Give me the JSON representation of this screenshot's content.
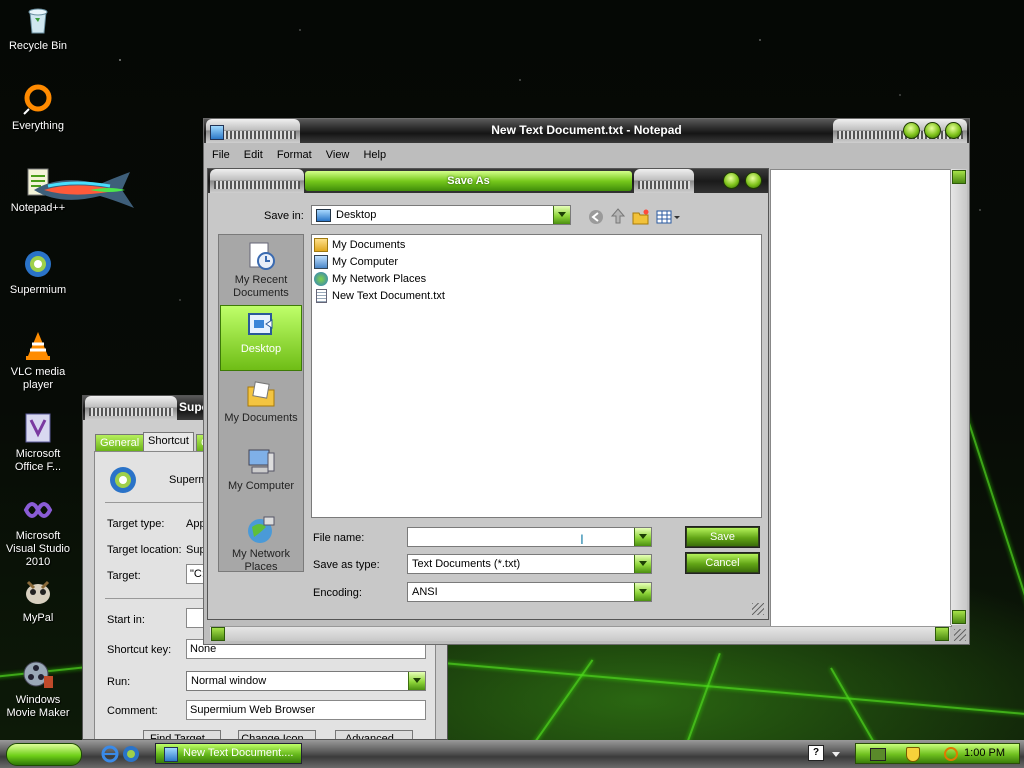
{
  "desktop": {
    "icons": [
      {
        "label": "Recycle Bin"
      },
      {
        "label": "Everything"
      },
      {
        "label": "Notepad++"
      },
      {
        "label": "Supermium"
      },
      {
        "label": "VLC media player"
      },
      {
        "label": "Microsoft Office F..."
      },
      {
        "label": "Microsoft Visual Studio 2010"
      },
      {
        "label": "MyPal"
      },
      {
        "label": "Windows Movie Maker"
      }
    ]
  },
  "notepad": {
    "title": "New Text Document.txt - Notepad",
    "menu": [
      "File",
      "Edit",
      "Format",
      "View",
      "Help"
    ]
  },
  "save_dialog": {
    "title": "Save As",
    "save_in_label": "Save in:",
    "save_in_value": "Desktop",
    "places": [
      "My Recent Documents",
      "Desktop",
      "My Documents",
      "My Computer",
      "My Network Places"
    ],
    "selected_place": "Desktop",
    "files": [
      "My Documents",
      "My Computer",
      "My Network Places",
      "New Text Document.txt"
    ],
    "file_name_label": "File name:",
    "file_name_value": "",
    "save_as_type_label": "Save as type:",
    "save_as_type_value": "Text Documents (*.txt)",
    "encoding_label": "Encoding:",
    "encoding_value": "ANSI",
    "save_button": "Save",
    "cancel_button": "Cancel"
  },
  "properties": {
    "title": "Supe",
    "tabs": [
      "General",
      "Shortcut",
      "C"
    ],
    "active_tab": "Shortcut",
    "app_name": "Superm",
    "target_type_label": "Target type:",
    "target_type_value": "App",
    "target_location_label": "Target location:",
    "target_location_value": "Sup",
    "target_label": "Target:",
    "target_value": "\"C:",
    "start_in_label": "Start in:",
    "shortcut_key_label": "Shortcut key:",
    "shortcut_key_value": "None",
    "run_label": "Run:",
    "run_value": "Normal window",
    "comment_label": "Comment:",
    "comment_value": "Supermium Web Browser",
    "buttons": [
      "Find Target...",
      "Change Icon...",
      "Advanced..."
    ]
  },
  "taskbar": {
    "task_label": "New Text Document....",
    "clock": "1:00 PM"
  },
  "colors": {
    "accent_green": "#6fbd16",
    "chrome_dark": "#1a1a1a",
    "chrome_silver": "#c8c8c8"
  }
}
